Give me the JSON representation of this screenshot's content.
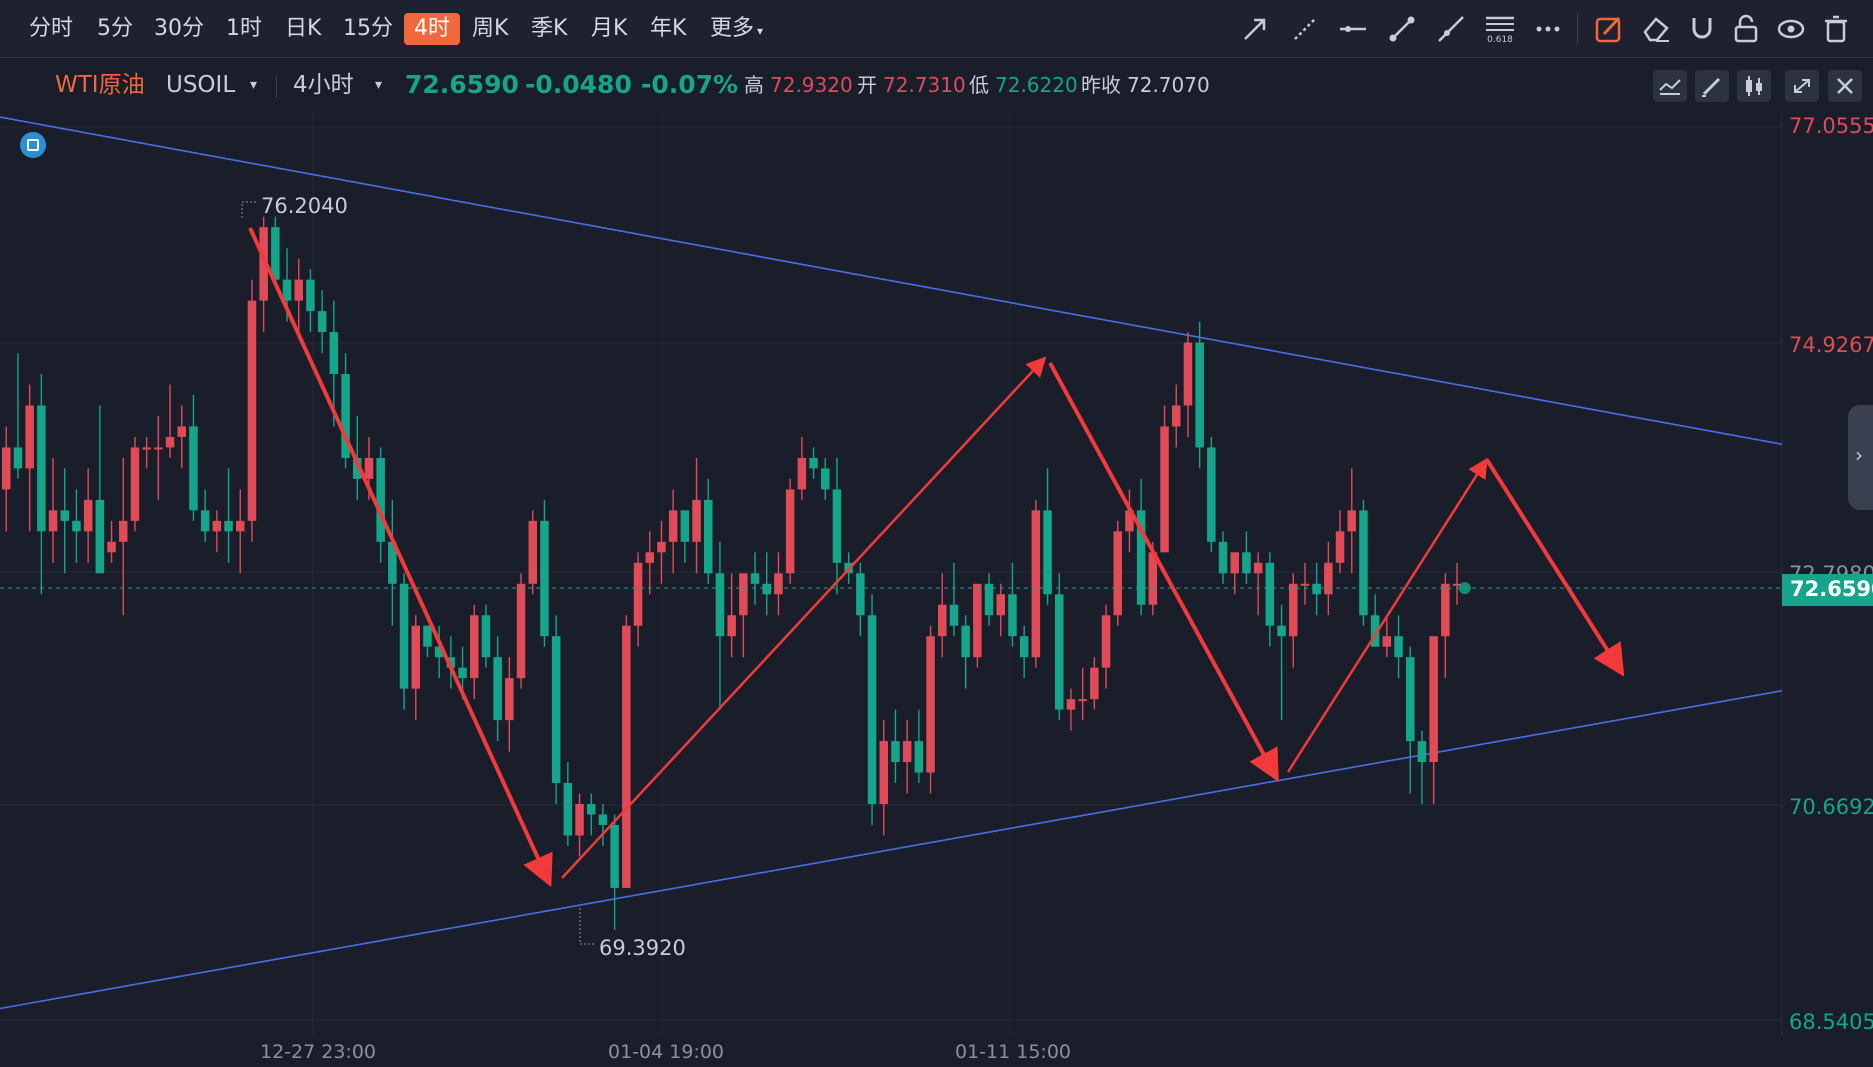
{
  "toolbar": {
    "timeframes": [
      "分时",
      "5分",
      "30分",
      "1时",
      "日K",
      "15分",
      "4时",
      "周K",
      "季K",
      "月K",
      "年K",
      "更多"
    ],
    "active_timeframe": "4时",
    "fib_label": "0.618",
    "icons": [
      "arrow-line-icon",
      "ray-icon",
      "horizontal-line-icon",
      "segment-icon",
      "extended-line-icon",
      "fibonacci-icon",
      "more-tools-icon",
      "draw-mode-icon",
      "eraser-icon",
      "magnet-icon",
      "unlock-icon",
      "eye-icon",
      "trash-icon"
    ]
  },
  "quote": {
    "name": "WTI原油",
    "code": "USOIL",
    "period": "4小时",
    "price": "72.6590",
    "change": "-0.0480",
    "change_pct": "-0.07%",
    "high_label": "高",
    "high": "72.9320",
    "open_label": "开",
    "open": "72.7310",
    "low_label": "低",
    "low": "72.6220",
    "prev_close_label": "昨收",
    "prev_close": "72.7070"
  },
  "colors": {
    "up": "#e04b57",
    "down": "#14a58a",
    "accent": "#f0683b",
    "trendline": "#4a6ee8",
    "arrow": "#f23a3a",
    "background": "#1a1e2b"
  },
  "chart_data": {
    "type": "candlestick",
    "instrument": "WTI原油 USOIL",
    "timeframe": "4小时",
    "y_axis_labels": [
      "77.0555",
      "74.9267",
      "72.7980",
      "70.6692",
      "68.5405"
    ],
    "x_axis_labels": [
      "12-27 23:00",
      "01-04 19:00",
      "01-11 15:00"
    ],
    "ylim": [
      68.5405,
      77.0555
    ],
    "current_price": "72.6590",
    "annotations": {
      "high_marker": "76.2040",
      "low_marker": "69.3920"
    },
    "candles": [
      [
        73.6,
        74.2,
        73.2,
        74.0
      ],
      [
        74.0,
        74.9,
        73.7,
        73.8
      ],
      [
        73.8,
        74.6,
        73.2,
        74.4
      ],
      [
        74.4,
        74.7,
        72.6,
        73.2
      ],
      [
        73.2,
        73.9,
        72.9,
        73.4
      ],
      [
        73.4,
        73.8,
        72.8,
        73.3
      ],
      [
        73.3,
        73.6,
        72.9,
        73.2
      ],
      [
        73.2,
        73.8,
        72.9,
        73.5
      ],
      [
        73.5,
        74.4,
        73.1,
        72.8
      ],
      [
        73.0,
        73.3,
        72.9,
        73.1
      ],
      [
        73.1,
        73.9,
        72.4,
        73.3
      ],
      [
        73.3,
        74.1,
        73.2,
        74.0
      ],
      [
        74.0,
        74.1,
        73.8,
        74.0
      ],
      [
        74.0,
        74.3,
        73.5,
        74.0
      ],
      [
        74.0,
        74.6,
        73.9,
        74.1
      ],
      [
        74.1,
        74.4,
        73.8,
        74.2
      ],
      [
        74.2,
        74.5,
        73.3,
        73.4
      ],
      [
        73.4,
        73.6,
        73.1,
        73.2
      ],
      [
        73.2,
        73.4,
        73.0,
        73.3
      ],
      [
        73.3,
        73.8,
        72.9,
        73.2
      ],
      [
        73.2,
        73.6,
        72.8,
        73.3
      ],
      [
        73.3,
        75.6,
        73.1,
        75.4
      ],
      [
        75.4,
        76.2,
        75.1,
        76.1
      ],
      [
        76.1,
        76.2,
        75.6,
        75.6
      ],
      [
        75.6,
        75.9,
        75.2,
        75.4
      ],
      [
        75.4,
        75.8,
        75.1,
        75.6
      ],
      [
        75.6,
        75.7,
        75.1,
        75.3
      ],
      [
        75.3,
        75.5,
        74.9,
        75.1
      ],
      [
        75.1,
        75.4,
        74.2,
        74.7
      ],
      [
        74.7,
        74.9,
        73.8,
        73.9
      ],
      [
        73.9,
        74.3,
        73.5,
        73.7
      ],
      [
        73.7,
        74.1,
        73.5,
        73.9
      ],
      [
        73.9,
        74.0,
        72.9,
        73.1
      ],
      [
        73.1,
        73.5,
        72.3,
        72.7
      ],
      [
        72.7,
        72.8,
        71.5,
        71.7
      ],
      [
        71.7,
        72.4,
        71.4,
        72.3
      ],
      [
        72.3,
        72.3,
        72.0,
        72.1
      ],
      [
        72.1,
        72.3,
        71.8,
        72.0
      ],
      [
        72.0,
        72.2,
        71.7,
        71.9
      ],
      [
        71.9,
        72.1,
        71.6,
        71.8
      ],
      [
        71.8,
        72.5,
        71.6,
        72.4
      ],
      [
        72.4,
        72.5,
        71.9,
        72.0
      ],
      [
        72.0,
        72.2,
        71.2,
        71.4
      ],
      [
        71.4,
        72.0,
        71.1,
        71.8
      ],
      [
        71.8,
        72.8,
        71.7,
        72.7
      ],
      [
        72.7,
        73.4,
        72.6,
        73.3
      ],
      [
        73.3,
        73.5,
        72.1,
        72.2
      ],
      [
        72.2,
        72.4,
        70.6,
        70.8
      ],
      [
        70.8,
        71.0,
        70.2,
        70.3
      ],
      [
        70.3,
        70.7,
        70.1,
        70.6
      ],
      [
        70.6,
        70.7,
        70.3,
        70.5
      ],
      [
        70.5,
        70.6,
        70.2,
        70.4
      ],
      [
        70.4,
        70.5,
        69.4,
        69.8
      ],
      [
        69.8,
        72.4,
        69.8,
        72.3
      ],
      [
        72.3,
        73.0,
        72.1,
        72.9
      ],
      [
        72.9,
        73.2,
        72.6,
        73.0
      ],
      [
        73.0,
        73.3,
        72.7,
        73.1
      ],
      [
        73.1,
        73.6,
        72.8,
        73.4
      ],
      [
        73.4,
        73.4,
        72.9,
        73.1
      ],
      [
        73.1,
        73.9,
        72.8,
        73.5
      ],
      [
        73.5,
        73.7,
        72.7,
        72.8
      ],
      [
        72.8,
        73.1,
        71.5,
        72.2
      ],
      [
        72.2,
        72.8,
        72.0,
        72.4
      ],
      [
        72.4,
        72.6,
        72.0,
        72.8
      ],
      [
        72.8,
        73.0,
        72.5,
        72.7
      ],
      [
        72.7,
        73.0,
        72.4,
        72.6
      ],
      [
        72.6,
        73.0,
        72.4,
        72.8
      ],
      [
        72.8,
        73.7,
        72.7,
        73.6
      ],
      [
        73.6,
        74.1,
        73.5,
        73.9
      ],
      [
        73.9,
        74.0,
        73.7,
        73.8
      ],
      [
        73.8,
        73.9,
        73.5,
        73.6
      ],
      [
        73.6,
        73.9,
        72.6,
        72.9
      ],
      [
        72.9,
        73.0,
        72.7,
        72.8
      ],
      [
        72.8,
        72.9,
        72.2,
        72.4
      ],
      [
        72.4,
        72.6,
        70.4,
        70.6
      ],
      [
        70.6,
        71.4,
        70.3,
        71.2
      ],
      [
        71.2,
        71.5,
        70.8,
        71.0
      ],
      [
        71.0,
        71.4,
        70.7,
        71.2
      ],
      [
        71.2,
        71.5,
        70.8,
        70.9
      ],
      [
        70.9,
        72.3,
        70.7,
        72.2
      ],
      [
        72.2,
        72.8,
        72.0,
        72.5
      ],
      [
        72.5,
        72.9,
        72.2,
        72.3
      ],
      [
        72.3,
        72.4,
        71.7,
        72.0
      ],
      [
        72.0,
        72.4,
        71.9,
        72.7
      ],
      [
        72.7,
        72.8,
        72.3,
        72.4
      ],
      [
        72.4,
        72.7,
        72.2,
        72.6
      ],
      [
        72.6,
        72.9,
        72.1,
        72.2
      ],
      [
        72.2,
        72.3,
        71.8,
        72.0
      ],
      [
        72.0,
        73.5,
        71.9,
        73.4
      ],
      [
        73.4,
        73.8,
        72.5,
        72.6
      ],
      [
        72.6,
        72.8,
        71.4,
        71.5
      ],
      [
        71.5,
        71.7,
        71.3,
        71.6
      ],
      [
        71.6,
        71.9,
        71.4,
        71.6
      ],
      [
        71.6,
        72.0,
        71.5,
        71.9
      ],
      [
        71.9,
        72.5,
        71.7,
        72.4
      ],
      [
        72.4,
        73.3,
        72.3,
        73.2
      ],
      [
        73.2,
        73.6,
        73.0,
        73.4
      ],
      [
        73.4,
        73.7,
        72.4,
        72.5
      ],
      [
        72.5,
        73.1,
        72.4,
        73.0
      ],
      [
        73.0,
        74.4,
        73.0,
        74.2
      ],
      [
        74.2,
        74.6,
        74.0,
        74.4
      ],
      [
        74.4,
        75.1,
        74.1,
        75.0
      ],
      [
        75.0,
        75.2,
        73.8,
        74.0
      ],
      [
        74.0,
        74.1,
        73.0,
        73.1
      ],
      [
        73.1,
        73.2,
        72.7,
        72.8
      ],
      [
        72.8,
        73.0,
        72.6,
        73.0
      ],
      [
        73.0,
        73.2,
        72.7,
        72.8
      ],
      [
        72.8,
        73.0,
        72.4,
        72.9
      ],
      [
        72.9,
        73.0,
        72.1,
        72.3
      ],
      [
        72.3,
        72.5,
        71.4,
        72.2
      ],
      [
        72.2,
        72.8,
        71.9,
        72.7
      ],
      [
        72.7,
        72.9,
        72.5,
        72.7
      ],
      [
        72.7,
        72.9,
        72.4,
        72.6
      ],
      [
        72.6,
        73.1,
        72.4,
        72.9
      ],
      [
        72.9,
        73.4,
        72.8,
        73.2
      ],
      [
        73.2,
        73.8,
        72.8,
        73.4
      ],
      [
        73.4,
        73.5,
        72.3,
        72.4
      ],
      [
        72.4,
        72.6,
        72.1,
        72.1
      ],
      [
        72.1,
        72.4,
        72.0,
        72.2
      ],
      [
        72.2,
        72.4,
        71.8,
        72.0
      ],
      [
        72.0,
        72.1,
        70.7,
        71.2
      ],
      [
        71.2,
        71.3,
        70.6,
        71.0
      ],
      [
        71.0,
        72.2,
        70.6,
        72.2
      ],
      [
        72.2,
        72.8,
        71.8,
        72.7
      ],
      [
        72.7,
        72.9,
        72.5,
        72.7
      ]
    ],
    "upper_trendline": [
      [
        0,
        77.15
      ],
      [
        1782,
        74.03
      ]
    ],
    "lower_trendline": [
      [
        0,
        68.65
      ],
      [
        1782,
        71.68
      ]
    ]
  }
}
